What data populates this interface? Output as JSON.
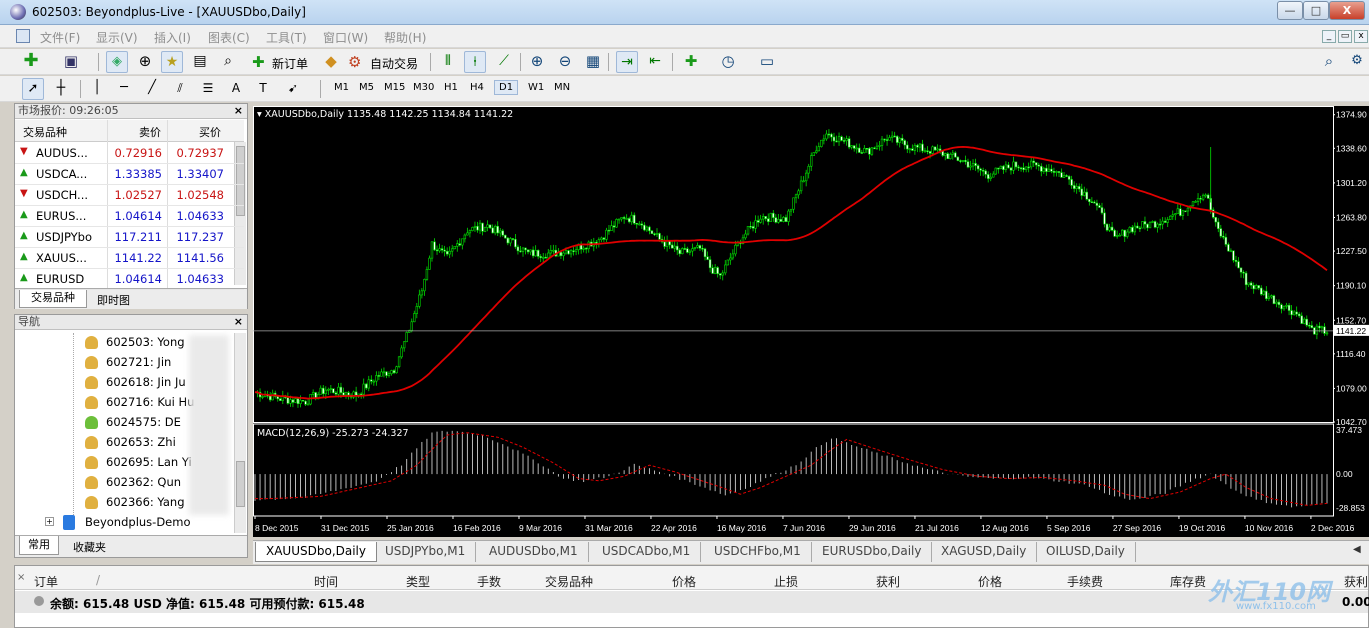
{
  "window": {
    "title": "602503: Beyondplus-Live - [XAUUSDbo,Daily]",
    "btn_min": "—",
    "btn_max": "□",
    "btn_close": "X"
  },
  "menu": [
    "文件(F)",
    "显示(V)",
    "插入(I)",
    "图表(C)",
    "工具(T)",
    "窗口(W)",
    "帮助(H)"
  ],
  "toolbar": {
    "new_order": "新订单",
    "auto_trade": "自动交易"
  },
  "timeframes": [
    "M1",
    "M5",
    "M15",
    "M30",
    "H1",
    "H4",
    "D1",
    "W1",
    "MN"
  ],
  "active_timeframe": "D1",
  "market_watch": {
    "title": "市场报价: 09:26:05",
    "col_symbol": "交易品种",
    "col_bid": "卖价",
    "col_ask": "买价",
    "rows": [
      {
        "symbol": "AUDUS...",
        "bid": "0.72916",
        "ask": "0.72937",
        "dir": "down"
      },
      {
        "symbol": "USDCA...",
        "bid": "1.33385",
        "ask": "1.33407",
        "dir": "up"
      },
      {
        "symbol": "USDCH...",
        "bid": "1.02527",
        "ask": "1.02548",
        "dir": "down"
      },
      {
        "symbol": "EURUS...",
        "bid": "1.04614",
        "ask": "1.04633",
        "dir": "up"
      },
      {
        "symbol": "USDJPYbo",
        "bid": "117.211",
        "ask": "117.237",
        "dir": "up"
      },
      {
        "symbol": "XAUUS...",
        "bid": "1141.22",
        "ask": "1141.56",
        "dir": "up"
      },
      {
        "symbol": "EURUSD",
        "bid": "1.04614",
        "ask": "1.04633",
        "dir": "up"
      }
    ],
    "tab1": "交易品种",
    "tab2": "即时图"
  },
  "navigator": {
    "title": "导航",
    "accounts": [
      "602503: Yong",
      "602721: Jin",
      "602618: Jin Ju",
      "602716: Kui Hu",
      "6024575: DE",
      "602653: Zhi",
      "602695: Lan Yi",
      "602362: Qun",
      "602366: Yang"
    ],
    "server": "Beyondplus-Demo",
    "tab1": "常用",
    "tab2": "收藏夹"
  },
  "chart": {
    "header": "XAUUSDbo,Daily  1135.48 1142.25 1134.84 1141.22",
    "price_labels": [
      "1374.90",
      "1338.60",
      "1301.20",
      "1263.80",
      "1227.50",
      "1190.10",
      "1152.70",
      "1116.40",
      "1079.00",
      "1042.70"
    ],
    "current_price": "1141.22",
    "macd_header": "MACD(12,26,9) -25.273 -24.327",
    "macd_labels": [
      "37.473",
      "0.00",
      "-28.853"
    ],
    "date_labels": [
      "8 Dec 2015",
      "31 Dec 2015",
      "25 Jan 2016",
      "16 Feb 2016",
      "9 Mar 2016",
      "31 Mar 2016",
      "22 Apr 2016",
      "16 May 2016",
      "7 Jun 2016",
      "29 Jun 2016",
      "21 Jul 2016",
      "12 Aug 2016",
      "5 Sep 2016",
      "27 Sep 2016",
      "19 Oct 2016",
      "10 Nov 2016",
      "2 Dec 2016"
    ],
    "colors": {
      "bg": "#000000",
      "candle": "#00e000",
      "ma": "#e00000",
      "macd": "#ffffff",
      "signal": "#e00000"
    }
  },
  "chart_tabs": [
    "XAUUSDbo,Daily",
    "USDJPYbo,M1",
    "AUDUSDbo,M1",
    "USDCADbo,M1",
    "USDCHFbo,M1",
    "EURUSDbo,Daily",
    "XAGUSD,Daily",
    "OILUSD,Daily"
  ],
  "terminal": {
    "headers": [
      "订单",
      "时间",
      "类型",
      "手数",
      "交易品种",
      "价格",
      "止损",
      "获利",
      "价格",
      "手续费",
      "库存费",
      "获利"
    ],
    "balance_line": "余额: 615.48 USD  净值: 615.48  可用预付款: 615.48",
    "profit": "0.00"
  },
  "watermark": {
    "cn": "外汇110网",
    "url": "www.fx110.com"
  }
}
